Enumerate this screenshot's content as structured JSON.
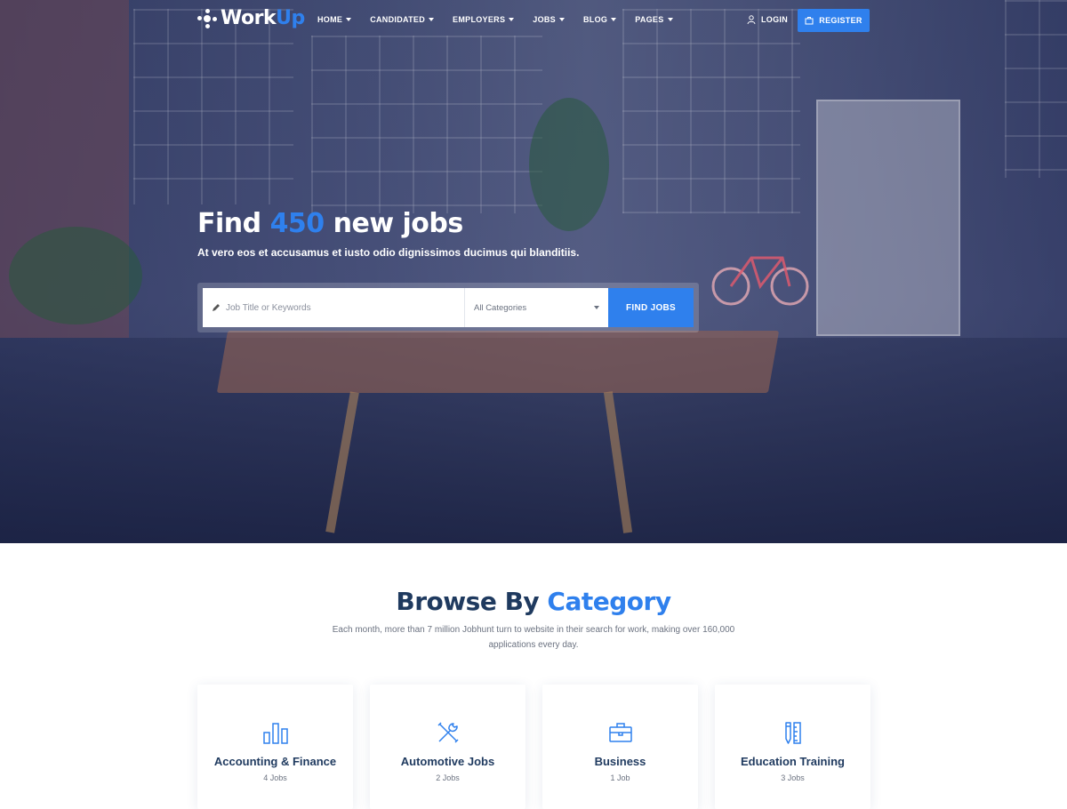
{
  "brand": {
    "name_main": "Work",
    "name_accent": "Up",
    "accent_color": "#2f80ed"
  },
  "nav": {
    "items": [
      {
        "label": "HOME"
      },
      {
        "label": "CANDIDATED"
      },
      {
        "label": "EMPLOYERS"
      },
      {
        "label": "JOBS"
      },
      {
        "label": "BLOG"
      },
      {
        "label": "PAGES"
      }
    ],
    "login_label": "LOGIN",
    "register_label": "REGISTER"
  },
  "hero": {
    "title_prefix": "Find ",
    "title_number": "450",
    "title_suffix": " new jobs",
    "subtitle": "At vero eos et accusamus et iusto odio dignissimos ducimus qui blanditiis."
  },
  "search": {
    "placeholder": "Job Title or Keywords",
    "category_selected": "All Categories",
    "button_label": "FIND JOBS"
  },
  "browse": {
    "title_main": "Browse By ",
    "title_accent": "Category",
    "description": "Each month, more than 7 million Jobhunt turn to website in their search for work, making over 160,000 applications every day."
  },
  "categories": [
    {
      "name": "Accounting & Finance",
      "count": "4 Jobs",
      "icon": "bar-chart-icon"
    },
    {
      "name": "Automotive Jobs",
      "count": "2 Jobs",
      "icon": "tools-icon"
    },
    {
      "name": "Business",
      "count": "1 Job",
      "icon": "briefcase-icon"
    },
    {
      "name": "Education Training",
      "count": "3 Jobs",
      "icon": "pencil-ruler-icon"
    }
  ]
}
